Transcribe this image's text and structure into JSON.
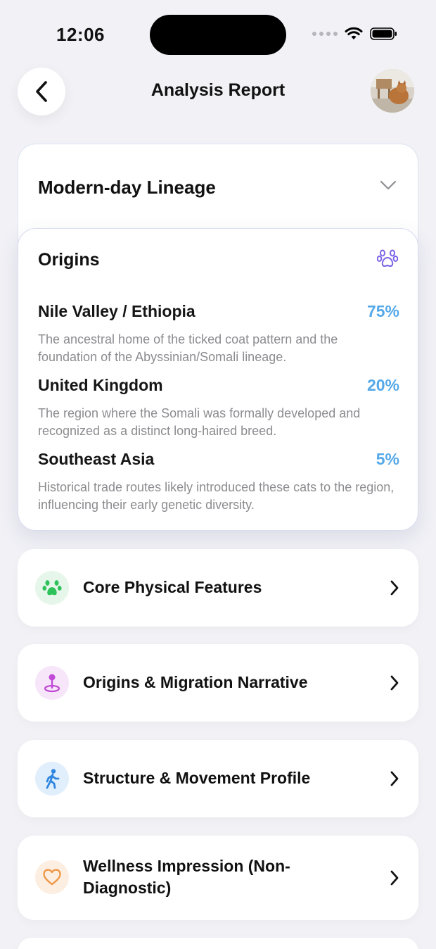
{
  "status_bar": {
    "time": "12:06"
  },
  "header": {
    "title": "Analysis Report"
  },
  "lineage": {
    "title": "Modern-day Lineage"
  },
  "origins": {
    "title": "Origins",
    "items": [
      {
        "name": "Nile Valley / Ethiopia",
        "percent": "75%",
        "description": "The ancestral home of the ticked coat pattern and the foundation of the Abyssinian/Somali lineage."
      },
      {
        "name": "United Kingdom",
        "percent": "20%",
        "description": "The region where the Somali was formally developed and recognized as a distinct long-haired breed."
      },
      {
        "name": "Southeast Asia",
        "percent": "5%",
        "description": "Historical trade routes likely introduced these cats to the region, influencing their early genetic diversity."
      }
    ]
  },
  "sections": [
    {
      "label": "Core Physical Features",
      "icon": "paw-icon",
      "color": "#2ec25b"
    },
    {
      "label": "Origins & Migration Narrative",
      "icon": "location-pin-icon",
      "color": "#c04ad6"
    },
    {
      "label": "Structure & Movement Profile",
      "icon": "walking-person-icon",
      "color": "#2f86e0"
    },
    {
      "label": "Wellness Impression (Non-Diagnostic)",
      "icon": "heart-icon",
      "color": "#ee9a4a"
    }
  ],
  "colors": {
    "accent_blue": "#55a9e9",
    "background": "#f1f1f6",
    "paw_purple": "#7b63e6"
  }
}
